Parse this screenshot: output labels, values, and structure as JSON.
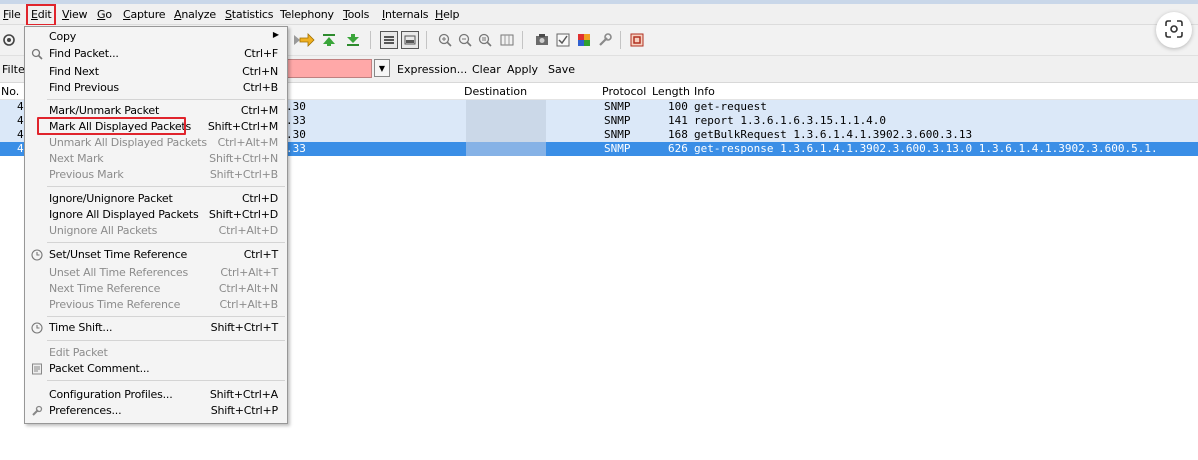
{
  "menubar": {
    "items": [
      "File",
      "Edit",
      "View",
      "Go",
      "Capture",
      "Analyze",
      "Statistics",
      "Telephony",
      "Tools",
      "Internals",
      "Help"
    ]
  },
  "toolbar": {
    "left_icon": "capture-options-icon",
    "icons": [
      "go-back-icon",
      "go-first-icon",
      "go-last-icon",
      "colorize-icon",
      "auto-scroll-icon",
      "zoom-in-icon",
      "zoom-out-icon",
      "normal-size-icon",
      "resize-columns-icon",
      "capture-filters-icon",
      "display-filters-icon",
      "coloring-rules-icon",
      "preferences-icon",
      "help-icon"
    ]
  },
  "filter": {
    "label": "Filte",
    "value": "",
    "expression": "Expression...",
    "clear": "Clear",
    "apply": "Apply",
    "save": "Save",
    "bg_color": "#ffa8a8"
  },
  "packet_list": {
    "columns": {
      "no": "No.",
      "destination": "Destination",
      "protocol": "Protocol",
      "length": "Length",
      "info": "Info"
    },
    "rows": [
      {
        "no": "4",
        "source_tail": ".30",
        "protocol": "SNMP",
        "length": "100",
        "info": "get-request",
        "selected": false
      },
      {
        "no": "4",
        "source_tail": ".33",
        "protocol": "SNMP",
        "length": "141",
        "info": "report 1.3.6.1.6.3.15.1.1.4.0",
        "selected": false
      },
      {
        "no": "4",
        "source_tail": ".30",
        "protocol": "SNMP",
        "length": "168",
        "info": "getBulkRequest 1.3.6.1.4.1.3902.3.600.3.13",
        "selected": false
      },
      {
        "no": "4",
        "source_tail": ".33",
        "protocol": "SNMP",
        "length": "626",
        "info": "get-response 1.3.6.1.4.1.3902.3.600.3.13.0 1.3.6.1.4.1.3902.3.600.5.1.",
        "selected": true
      }
    ],
    "row_color": "#dbe8f8",
    "selected_color": "#3a8ee6"
  },
  "edit_menu": {
    "copy": {
      "label": "Copy"
    },
    "find_packet": {
      "label": "Find Packet...",
      "shortcut": "Ctrl+F"
    },
    "find_next": {
      "label": "Find Next",
      "shortcut": "Ctrl+N"
    },
    "find_previous": {
      "label": "Find Previous",
      "shortcut": "Ctrl+B"
    },
    "mark_unmark": {
      "label": "Mark/Unmark Packet",
      "shortcut": "Ctrl+M"
    },
    "mark_all": {
      "label": "Mark All Displayed Packets",
      "shortcut": "Shift+Ctrl+M"
    },
    "unmark_all": {
      "label": "Unmark All Displayed Packets",
      "shortcut": "Ctrl+Alt+M"
    },
    "next_mark": {
      "label": "Next Mark",
      "shortcut": "Shift+Ctrl+N"
    },
    "previous_mark": {
      "label": "Previous Mark",
      "shortcut": "Shift+Ctrl+B"
    },
    "ignore_unignore": {
      "label": "Ignore/Unignore Packet",
      "shortcut": "Ctrl+D"
    },
    "ignore_all": {
      "label": "Ignore All Displayed Packets",
      "shortcut": "Shift+Ctrl+D"
    },
    "unignore_all": {
      "label": "Unignore All Packets",
      "shortcut": "Ctrl+Alt+D"
    },
    "set_time_ref": {
      "label": "Set/Unset Time Reference",
      "shortcut": "Ctrl+T"
    },
    "unset_all_time_ref": {
      "label": "Unset All Time References",
      "shortcut": "Ctrl+Alt+T"
    },
    "next_time_ref": {
      "label": "Next Time Reference",
      "shortcut": "Ctrl+Alt+N"
    },
    "previous_time_ref": {
      "label": "Previous Time Reference",
      "shortcut": "Ctrl+Alt+B"
    },
    "time_shift": {
      "label": "Time Shift...",
      "shortcut": "Shift+Ctrl+T"
    },
    "edit_packet": {
      "label": "Edit Packet"
    },
    "packet_comment": {
      "label": "Packet Comment..."
    },
    "config_profiles": {
      "label": "Configuration Profiles...",
      "shortcut": "Shift+Ctrl+A"
    },
    "preferences": {
      "label": "Preferences...",
      "shortcut": "Shift+Ctrl+P"
    },
    "highlight_color": "#e0242c"
  }
}
